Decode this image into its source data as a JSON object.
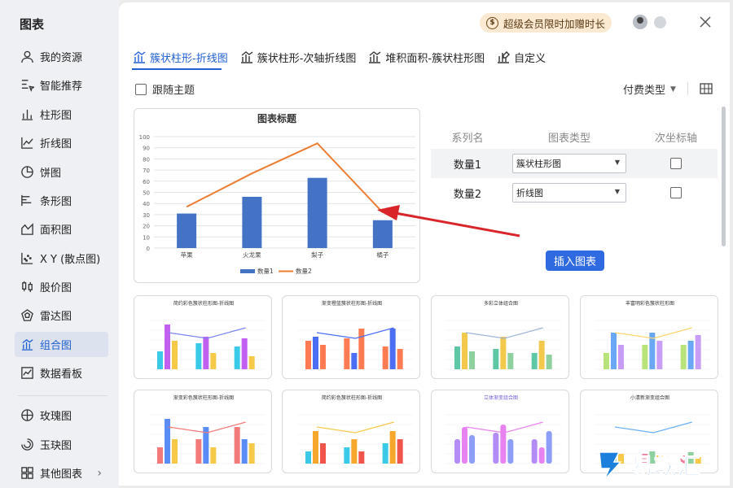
{
  "sidebar": {
    "title": "图表",
    "items": [
      {
        "label": "我的资源",
        "icon": "user-icon"
      },
      {
        "label": "智能推荐",
        "icon": "smart-recommend-icon"
      },
      {
        "label": "柱形图",
        "icon": "column-chart-icon"
      },
      {
        "label": "折线图",
        "icon": "line-chart-icon"
      },
      {
        "label": "饼图",
        "icon": "pie-chart-icon"
      },
      {
        "label": "条形图",
        "icon": "bar-chart-icon"
      },
      {
        "label": "面积图",
        "icon": "area-chart-icon"
      },
      {
        "label": "X Y (散点图)",
        "icon": "scatter-chart-icon"
      },
      {
        "label": "股价图",
        "icon": "stock-chart-icon"
      },
      {
        "label": "雷达图",
        "icon": "radar-chart-icon"
      },
      {
        "label": "组合图",
        "icon": "combo-chart-icon",
        "active": true
      },
      {
        "label": "数据看板",
        "icon": "dashboard-icon"
      },
      {
        "label": "玫瑰图",
        "icon": "rose-chart-icon"
      },
      {
        "label": "玉玦图",
        "icon": "jade-chart-icon"
      },
      {
        "label": "其他图表",
        "icon": "other-chart-icon"
      }
    ]
  },
  "header": {
    "vip_text": "超级会员限时加赠时长",
    "vip_icon_glyph": "$"
  },
  "tabs": [
    {
      "label": "簇状柱形-折线图",
      "active": true
    },
    {
      "label": "簇状柱形-次轴折线图"
    },
    {
      "label": "堆积面积-簇状柱形图"
    },
    {
      "label": "自定义"
    }
  ],
  "toolbar": {
    "follow_theme_label": "跟随主题",
    "paid_type_label": "付费类型"
  },
  "series_table": {
    "headers": [
      "系列名",
      "图表类型",
      "次坐标轴"
    ],
    "rows": [
      {
        "name": "数量1",
        "type": "簇状柱形图",
        "secondary": false
      },
      {
        "name": "数量2",
        "type": "折线图",
        "secondary": false
      }
    ]
  },
  "insert_button": "插入图表",
  "preview": {
    "title": "图表标题",
    "y_ticks": [
      "0",
      "10",
      "20",
      "30",
      "40",
      "50",
      "60",
      "70",
      "80",
      "90",
      "100"
    ],
    "legend": [
      "数量1",
      "数量2"
    ]
  },
  "chart_data": {
    "type": "bar",
    "title": "图表标题",
    "categories": [
      "苹果",
      "火龙果",
      "梨子",
      "橘子"
    ],
    "series": [
      {
        "name": "数量1",
        "type": "bar",
        "values": [
          31,
          46,
          63,
          25
        ]
      },
      {
        "name": "数量2",
        "type": "line",
        "values": [
          37,
          67,
          94,
          32
        ]
      }
    ],
    "ylim": [
      0,
      100
    ],
    "grid": true,
    "legend_position": "bottom",
    "colors": {
      "bar": "#4472c4",
      "line": "#ed7d31"
    }
  },
  "thumbnails": [
    {
      "title": "简约彩色簇状柱形图-折线图"
    },
    {
      "title": "渐变橙蓝簇状柱形图-折线图"
    },
    {
      "title": "多彩立体组合图"
    },
    {
      "title": "丰富明彩色簇状柱形图"
    },
    {
      "title": "渐变彩色簇状柱形图-折线图"
    },
    {
      "title": "简约彩色簇状柱形图-折线图"
    },
    {
      "title": "立体渐变组合图"
    },
    {
      "title": "小清新渐变组合图"
    }
  ],
  "watermark": {
    "text": "易软汇"
  },
  "colors": {
    "accent": "#1f5fd1",
    "button": "#2f6ae0",
    "arrow": "#d9252a"
  }
}
